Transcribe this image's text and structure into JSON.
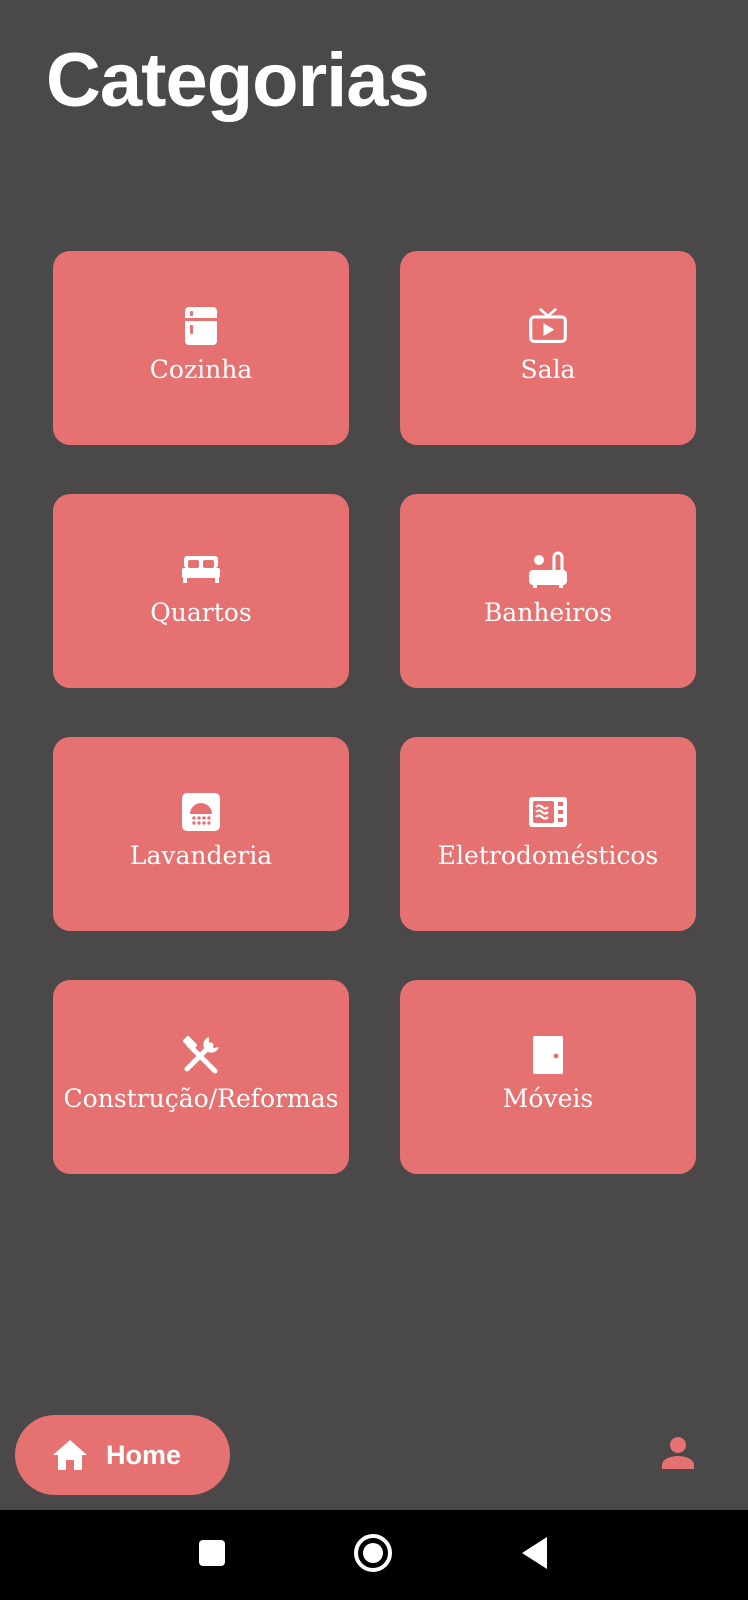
{
  "header": {
    "title": "Categorias"
  },
  "categories": [
    {
      "label": "Cozinha",
      "icon": "fridge-icon"
    },
    {
      "label": "Sala",
      "icon": "tv-icon"
    },
    {
      "label": "Quartos",
      "icon": "bed-icon"
    },
    {
      "label": "Banheiros",
      "icon": "bathtub-icon"
    },
    {
      "label": "Lavanderia",
      "icon": "washing-machine-icon"
    },
    {
      "label": "Eletrodomésticos",
      "icon": "microwave-icon"
    },
    {
      "label": "Construção/Reformas",
      "icon": "tools-icon"
    },
    {
      "label": "Móveis",
      "icon": "door-icon"
    }
  ],
  "bottom_nav": {
    "home_label": "Home",
    "home_icon": "home-icon",
    "profile_icon": "person-icon"
  },
  "system_nav": {
    "recents_icon": "square-icon",
    "home_icon": "circle-icon",
    "back_icon": "triangle-back-icon"
  },
  "colors": {
    "background": "#4a4849",
    "accent": "#e57171",
    "text": "#ffffff",
    "system_bar": "#000000"
  }
}
